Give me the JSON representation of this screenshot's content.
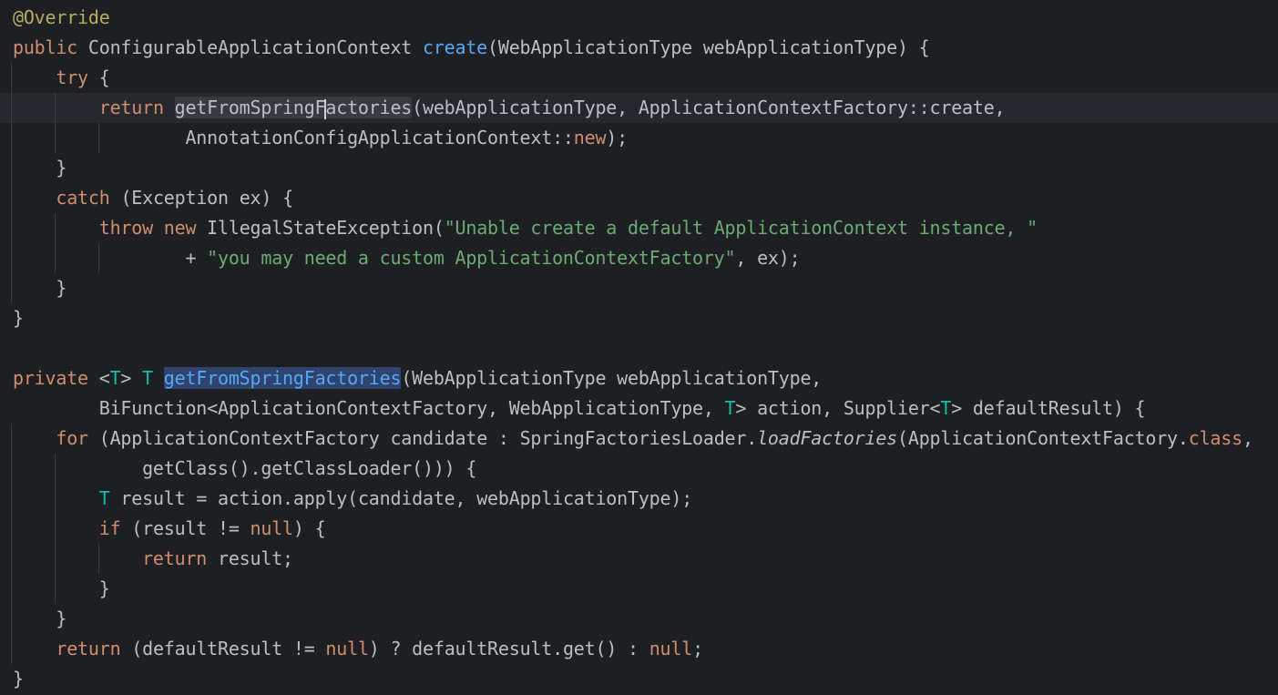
{
  "editor": {
    "theme_colors": {
      "background": "#1e1f22",
      "current_line": "#26282e",
      "text": "#bcbec4",
      "keyword": "#cf8e6d",
      "annotation": "#b3ae60",
      "method_declaration": "#56a8f5",
      "string": "#6aab73",
      "type_parameter": "#16baac"
    },
    "current_line_index": 3,
    "caret_line_index": 3,
    "highlighted_symbol": "getFromSpringFactories",
    "lines": [
      "@Override",
      "public ConfigurableApplicationContext create(WebApplicationType webApplicationType) {",
      "    try {",
      "        return getFromSpringFactories(webApplicationType, ApplicationContextFactory::create,",
      "                AnnotationConfigApplicationContext::new);",
      "    }",
      "    catch (Exception ex) {",
      "        throw new IllegalStateException(\"Unable create a default ApplicationContext instance, \"",
      "                + \"you may need a custom ApplicationContextFactory\", ex);",
      "    }",
      "}",
      "",
      "private <T> T getFromSpringFactories(WebApplicationType webApplicationType,",
      "        BiFunction<ApplicationContextFactory, WebApplicationType, T> action, Supplier<T> defaultResult) {",
      "    for (ApplicationContextFactory candidate : SpringFactoriesLoader.loadFactories(ApplicationContextFactory.class,",
      "            getClass().getClassLoader())) {",
      "        T result = action.apply(candidate, webApplicationType);",
      "        if (result != null) {",
      "            return result;",
      "        }",
      "    }",
      "    return (defaultResult != null) ? defaultResult.get() : null;",
      "}"
    ]
  }
}
